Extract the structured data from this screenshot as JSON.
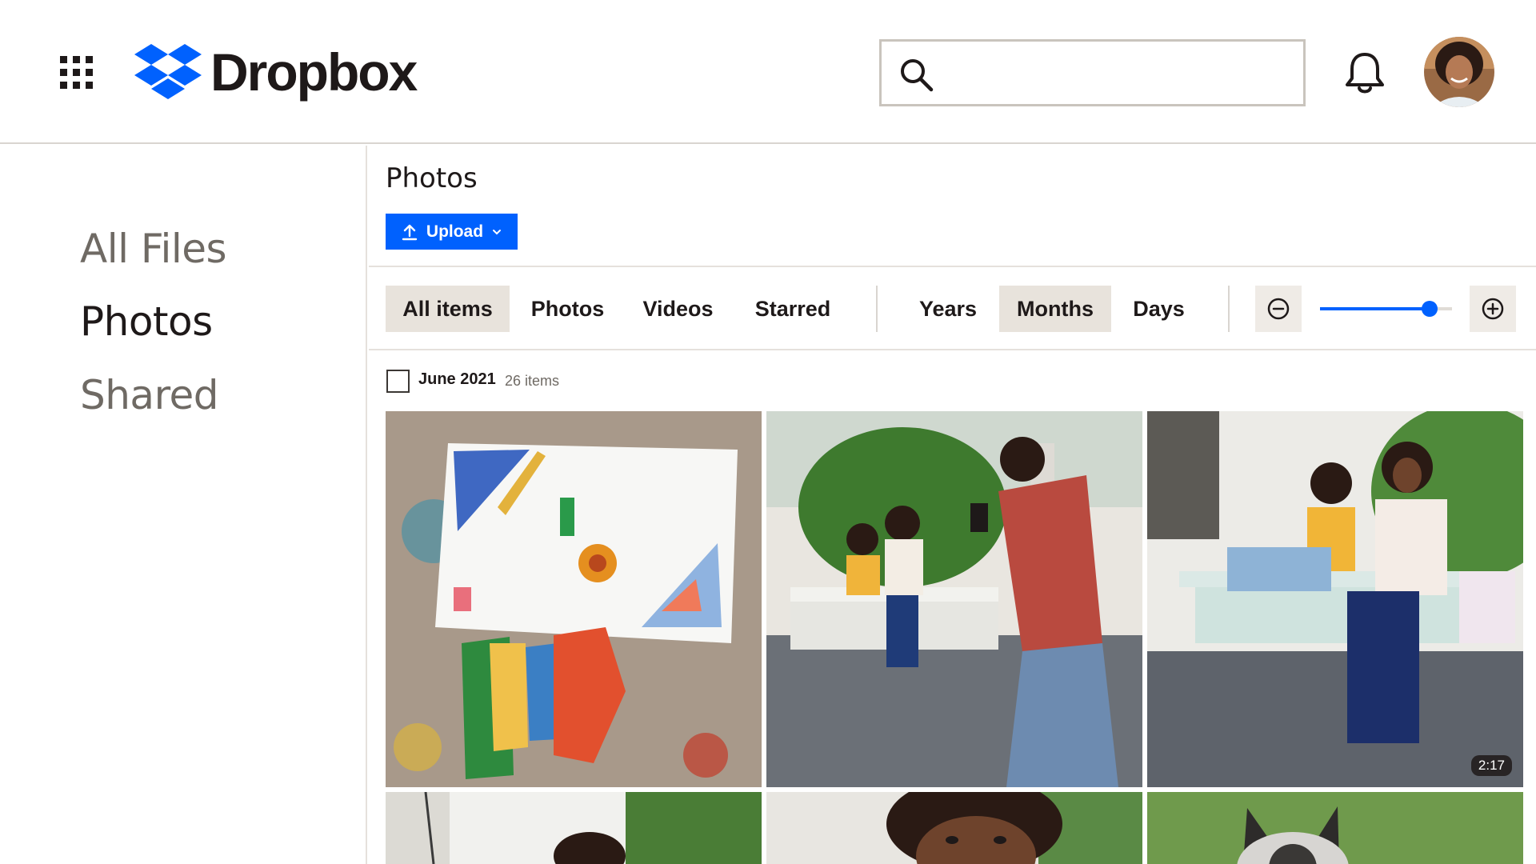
{
  "header": {
    "brand": "Dropbox",
    "search_value": "",
    "icons": {
      "apps": "grid-icon",
      "search": "search-icon",
      "notifications": "bell-icon",
      "profile": "avatar"
    }
  },
  "sidebar": {
    "items": [
      {
        "label": "All Files",
        "active": false
      },
      {
        "label": "Photos",
        "active": true
      },
      {
        "label": "Shared",
        "active": false
      }
    ]
  },
  "main": {
    "title": "Photos",
    "upload_label": "Upload",
    "type_filters": [
      {
        "label": "All items",
        "selected": true
      },
      {
        "label": "Photos",
        "selected": false
      },
      {
        "label": "Videos",
        "selected": false
      },
      {
        "label": "Starred",
        "selected": false
      }
    ],
    "time_filters": [
      {
        "label": "Years",
        "selected": false
      },
      {
        "label": "Months",
        "selected": true
      },
      {
        "label": "Days",
        "selected": false
      }
    ],
    "zoom_level": 0.83,
    "group": {
      "label": "June 2021",
      "count": "26 items"
    },
    "photos": [
      {
        "subject": "collage artwork on canvas",
        "video": false
      },
      {
        "subject": "man photographing family on porch swing",
        "video": false
      },
      {
        "subject": "mother and son on porch swing",
        "video": true,
        "duration": "2:17"
      },
      {
        "subject": "child on porch swing",
        "video": false
      },
      {
        "subject": "smiling child close-up",
        "video": false
      },
      {
        "subject": "dog on grass",
        "video": false
      }
    ]
  },
  "colors": {
    "accent": "#0061fe",
    "text": "#1e1919",
    "muted": "#6f6a64",
    "selected_bg": "#e8e3dc",
    "border": "#d9d5d0"
  }
}
